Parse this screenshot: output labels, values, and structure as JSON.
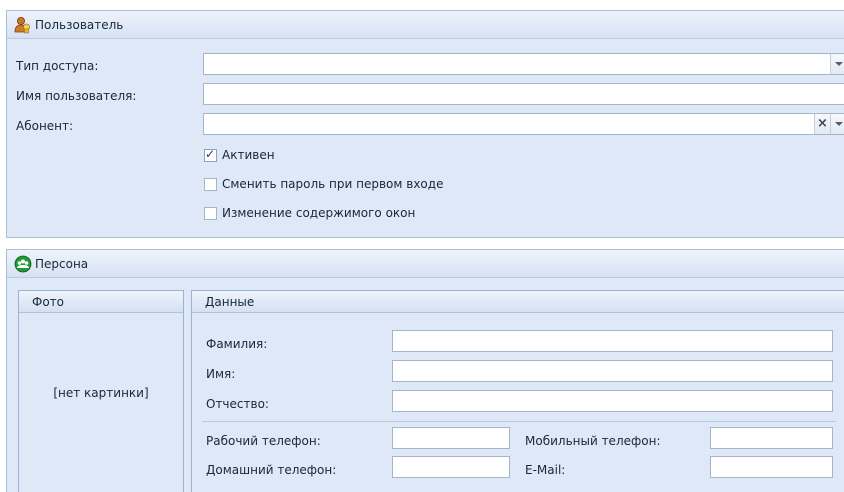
{
  "user_section": {
    "title": "Пользователь",
    "access_type_label": "Тип доступа:",
    "access_type_value": "",
    "username_label": "Имя пользователя:",
    "username_value": "",
    "subscriber_label": "Абонент:",
    "subscriber_value": "",
    "active_label": "Активен",
    "active_checked": true,
    "change_password_label": "Сменить пароль при первом входе",
    "change_password_checked": false,
    "window_content_label": "Изменение содержимого окон",
    "window_content_checked": false
  },
  "person_section": {
    "title": "Персона",
    "photo_panel": {
      "title": "Фото",
      "placeholder": "[нет картинки]"
    },
    "data_panel": {
      "title": "Данные",
      "last_name_label": "Фамилия:",
      "first_name_label": "Имя:",
      "patronymic_label": "Отчество:",
      "work_phone_label": "Рабочий телефон:",
      "home_phone_label": "Домашний телефон:",
      "mobile_phone_label": "Мобильный телефон:",
      "email_label": "E-Mail:"
    }
  },
  "icons": {
    "user_icon": "user-icon",
    "person_icon": "people-group-icon"
  },
  "colors": {
    "panel_background": "#dfe8f6",
    "border": "#a9bfd6"
  }
}
